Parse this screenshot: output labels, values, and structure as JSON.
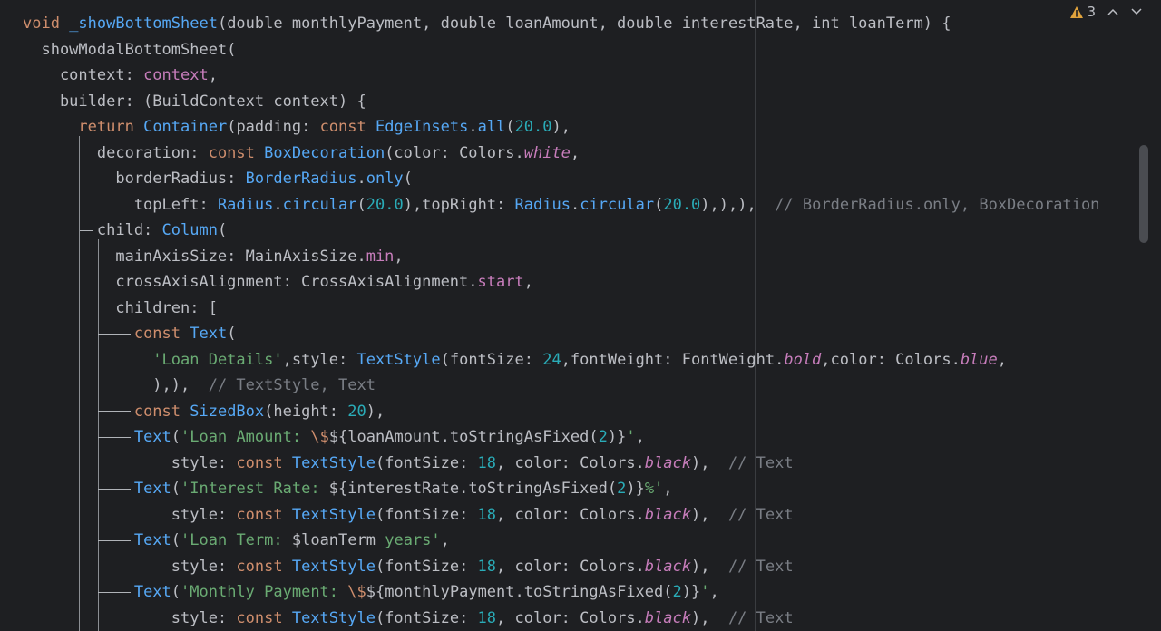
{
  "editor": {
    "inspection": {
      "warning_count": "3",
      "warning_icon": "warning-triangle-icon",
      "prev_icon": "chevron-up-icon",
      "next_icon": "chevron-down-icon"
    },
    "colors": {
      "background": "#1e1f22",
      "keyword": "#cf8e6d",
      "function": "#56a8f5",
      "string": "#6aab73",
      "number": "#2aacb8",
      "property": "#c77dbb",
      "comment": "#7a7e85",
      "text": "#bcbec4",
      "warning": "#e0a23c"
    },
    "code_lines": [
      {
        "tokens": [
          [
            "kw",
            "void "
          ],
          [
            "fn",
            "_showBottomSheet"
          ],
          [
            "plain",
            "(double monthlyPayment, double loanAmount, double interestRate, int loanTerm) {"
          ]
        ]
      },
      {
        "tokens": [
          [
            "plain",
            "  showModalBottomSheet("
          ]
        ]
      },
      {
        "tokens": [
          [
            "plain",
            "    context: "
          ],
          [
            "prop",
            "context"
          ],
          [
            "plain",
            ","
          ]
        ]
      },
      {
        "tokens": [
          [
            "plain",
            "    builder: (BuildContext context) {"
          ]
        ]
      },
      {
        "tokens": [
          [
            "plain",
            "      "
          ],
          [
            "kw",
            "return "
          ],
          [
            "cls",
            "Container"
          ],
          [
            "plain",
            "(padding: "
          ],
          [
            "kw",
            "const "
          ],
          [
            "cls",
            "EdgeInsets"
          ],
          [
            "plain",
            "."
          ],
          [
            "fn",
            "all"
          ],
          [
            "plain",
            "("
          ],
          [
            "num",
            "20.0"
          ],
          [
            "plain",
            "),"
          ]
        ]
      },
      {
        "tokens": [
          [
            "plain",
            "        decoration: "
          ],
          [
            "kw",
            "const "
          ],
          [
            "cls",
            "BoxDecoration"
          ],
          [
            "plain",
            "(color: Colors."
          ],
          [
            "it",
            "white"
          ],
          [
            "plain",
            ","
          ]
        ]
      },
      {
        "tokens": [
          [
            "plain",
            "          borderRadius: "
          ],
          [
            "cls",
            "BorderRadius"
          ],
          [
            "plain",
            "."
          ],
          [
            "fn",
            "only"
          ],
          [
            "plain",
            "("
          ]
        ]
      },
      {
        "tokens": [
          [
            "plain",
            "            topLeft: "
          ],
          [
            "cls",
            "Radius"
          ],
          [
            "plain",
            "."
          ],
          [
            "fn",
            "circular"
          ],
          [
            "plain",
            "("
          ],
          [
            "num",
            "20.0"
          ],
          [
            "plain",
            "),topRight: "
          ],
          [
            "cls",
            "Radius"
          ],
          [
            "plain",
            "."
          ],
          [
            "fn",
            "circular"
          ],
          [
            "plain",
            "("
          ],
          [
            "num",
            "20.0"
          ],
          [
            "plain",
            "),),),  "
          ],
          [
            "cmt",
            "// BorderRadius.only, BoxDecoration"
          ]
        ]
      },
      {
        "tokens": [
          [
            "plain",
            "        child: "
          ],
          [
            "cls",
            "Column"
          ],
          [
            "plain",
            "("
          ]
        ]
      },
      {
        "tokens": [
          [
            "plain",
            "          mainAxisSize: MainAxisSize."
          ],
          [
            "prop",
            "min"
          ],
          [
            "plain",
            ","
          ]
        ]
      },
      {
        "tokens": [
          [
            "plain",
            "          crossAxisAlignment: CrossAxisAlignment."
          ],
          [
            "prop",
            "start"
          ],
          [
            "plain",
            ","
          ]
        ]
      },
      {
        "tokens": [
          [
            "plain",
            "          children: ["
          ]
        ]
      },
      {
        "tokens": [
          [
            "plain",
            "            "
          ],
          [
            "kw",
            "const "
          ],
          [
            "cls",
            "Text"
          ],
          [
            "plain",
            "("
          ]
        ]
      },
      {
        "tokens": [
          [
            "plain",
            "              "
          ],
          [
            "str",
            "'Loan Details'"
          ],
          [
            "plain",
            ",style: "
          ],
          [
            "cls",
            "TextStyle"
          ],
          [
            "plain",
            "(fontSize: "
          ],
          [
            "num",
            "24"
          ],
          [
            "plain",
            ",fontWeight: FontWeight."
          ],
          [
            "it",
            "bold"
          ],
          [
            "plain",
            ",color: Colors."
          ],
          [
            "it",
            "blue"
          ],
          [
            "plain",
            ","
          ]
        ]
      },
      {
        "tokens": [
          [
            "plain",
            "              ),),  "
          ],
          [
            "cmt",
            "// TextStyle, Text"
          ]
        ]
      },
      {
        "tokens": [
          [
            "plain",
            "            "
          ],
          [
            "kw",
            "const "
          ],
          [
            "cls",
            "SizedBox"
          ],
          [
            "plain",
            "(height: "
          ],
          [
            "num",
            "20"
          ],
          [
            "plain",
            "),"
          ]
        ]
      },
      {
        "tokens": [
          [
            "plain",
            "            "
          ],
          [
            "cls",
            "Text"
          ],
          [
            "plain",
            "("
          ],
          [
            "str",
            "'Loan Amount: "
          ],
          [
            "kw",
            "\\$"
          ],
          [
            "plain",
            "${loanAmount.toStringAsFixed("
          ],
          [
            "num",
            "2"
          ],
          [
            "plain",
            ")}"
          ],
          [
            "str",
            "'"
          ],
          [
            "plain",
            ","
          ]
        ]
      },
      {
        "tokens": [
          [
            "plain",
            "                style: "
          ],
          [
            "kw",
            "const "
          ],
          [
            "cls",
            "TextStyle"
          ],
          [
            "plain",
            "(fontSize: "
          ],
          [
            "num",
            "18"
          ],
          [
            "plain",
            ", color: Colors."
          ],
          [
            "it",
            "black"
          ],
          [
            "plain",
            "),  "
          ],
          [
            "cmt",
            "// Text"
          ]
        ]
      },
      {
        "tokens": [
          [
            "plain",
            "            "
          ],
          [
            "cls",
            "Text"
          ],
          [
            "plain",
            "("
          ],
          [
            "str",
            "'Interest Rate: "
          ],
          [
            "plain",
            "${interestRate.toStringAsFixed("
          ],
          [
            "num",
            "2"
          ],
          [
            "plain",
            ")}"
          ],
          [
            "str",
            "%'"
          ],
          [
            "plain",
            ","
          ]
        ]
      },
      {
        "tokens": [
          [
            "plain",
            "                style: "
          ],
          [
            "kw",
            "const "
          ],
          [
            "cls",
            "TextStyle"
          ],
          [
            "plain",
            "(fontSize: "
          ],
          [
            "num",
            "18"
          ],
          [
            "plain",
            ", color: Colors."
          ],
          [
            "it",
            "black"
          ],
          [
            "plain",
            "),  "
          ],
          [
            "cmt",
            "// Text"
          ]
        ]
      },
      {
        "tokens": [
          [
            "plain",
            "            "
          ],
          [
            "cls",
            "Text"
          ],
          [
            "plain",
            "("
          ],
          [
            "str",
            "'Loan Term: "
          ],
          [
            "plain",
            "$loanTerm"
          ],
          [
            "str",
            " years'"
          ],
          [
            "plain",
            ","
          ]
        ]
      },
      {
        "tokens": [
          [
            "plain",
            "                style: "
          ],
          [
            "kw",
            "const "
          ],
          [
            "cls",
            "TextStyle"
          ],
          [
            "plain",
            "(fontSize: "
          ],
          [
            "num",
            "18"
          ],
          [
            "plain",
            ", color: Colors."
          ],
          [
            "it",
            "black"
          ],
          [
            "plain",
            "),  "
          ],
          [
            "cmt",
            "// Text"
          ]
        ]
      },
      {
        "tokens": [
          [
            "plain",
            "            "
          ],
          [
            "cls",
            "Text"
          ],
          [
            "plain",
            "("
          ],
          [
            "str",
            "'Monthly Payment: "
          ],
          [
            "kw",
            "\\$"
          ],
          [
            "plain",
            "${monthlyPayment.toStringAsFixed("
          ],
          [
            "num",
            "2"
          ],
          [
            "plain",
            ")}"
          ],
          [
            "str",
            "'"
          ],
          [
            "plain",
            ","
          ]
        ]
      },
      {
        "tokens": [
          [
            "plain",
            "                style: "
          ],
          [
            "kw",
            "const "
          ],
          [
            "cls",
            "TextStyle"
          ],
          [
            "plain",
            "(fontSize: "
          ],
          [
            "num",
            "18"
          ],
          [
            "plain",
            ", color: Colors."
          ],
          [
            "it",
            "black"
          ],
          [
            "plain",
            "),  "
          ],
          [
            "cmt",
            "// Text"
          ]
        ]
      }
    ]
  }
}
